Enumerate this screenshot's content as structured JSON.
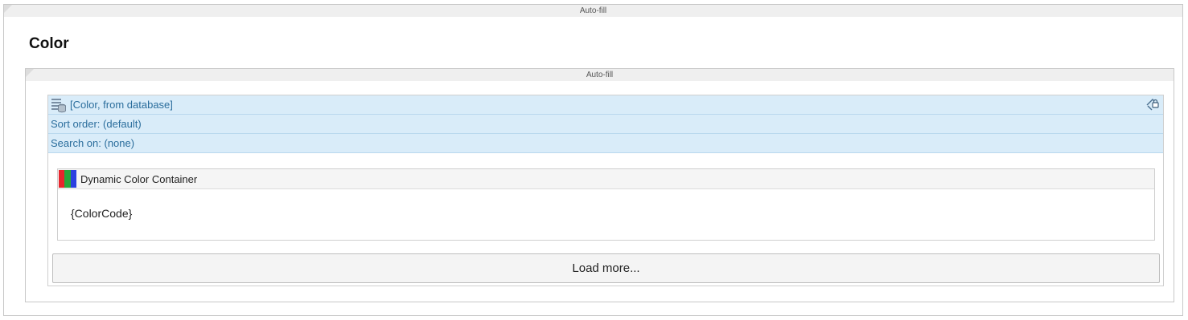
{
  "outer_panel": {
    "caption": "Auto-fill"
  },
  "page": {
    "title": "Color"
  },
  "inner_panel": {
    "caption": "Auto-fill"
  },
  "list_view": {
    "datasource": "[Color, from database]",
    "sort_order": "Sort order: (default)",
    "search_on": "Search on: (none)",
    "datasource_icon": "database-icon",
    "access_icon": "access-rules-icon"
  },
  "container": {
    "title": "Dynamic Color Container",
    "icon": "color-bars-icon",
    "icon_colors": [
      "#e8262d",
      "#26a83b",
      "#2a3fe0"
    ],
    "content": "{ColorCode}"
  },
  "load_more": {
    "label": "Load more..."
  }
}
